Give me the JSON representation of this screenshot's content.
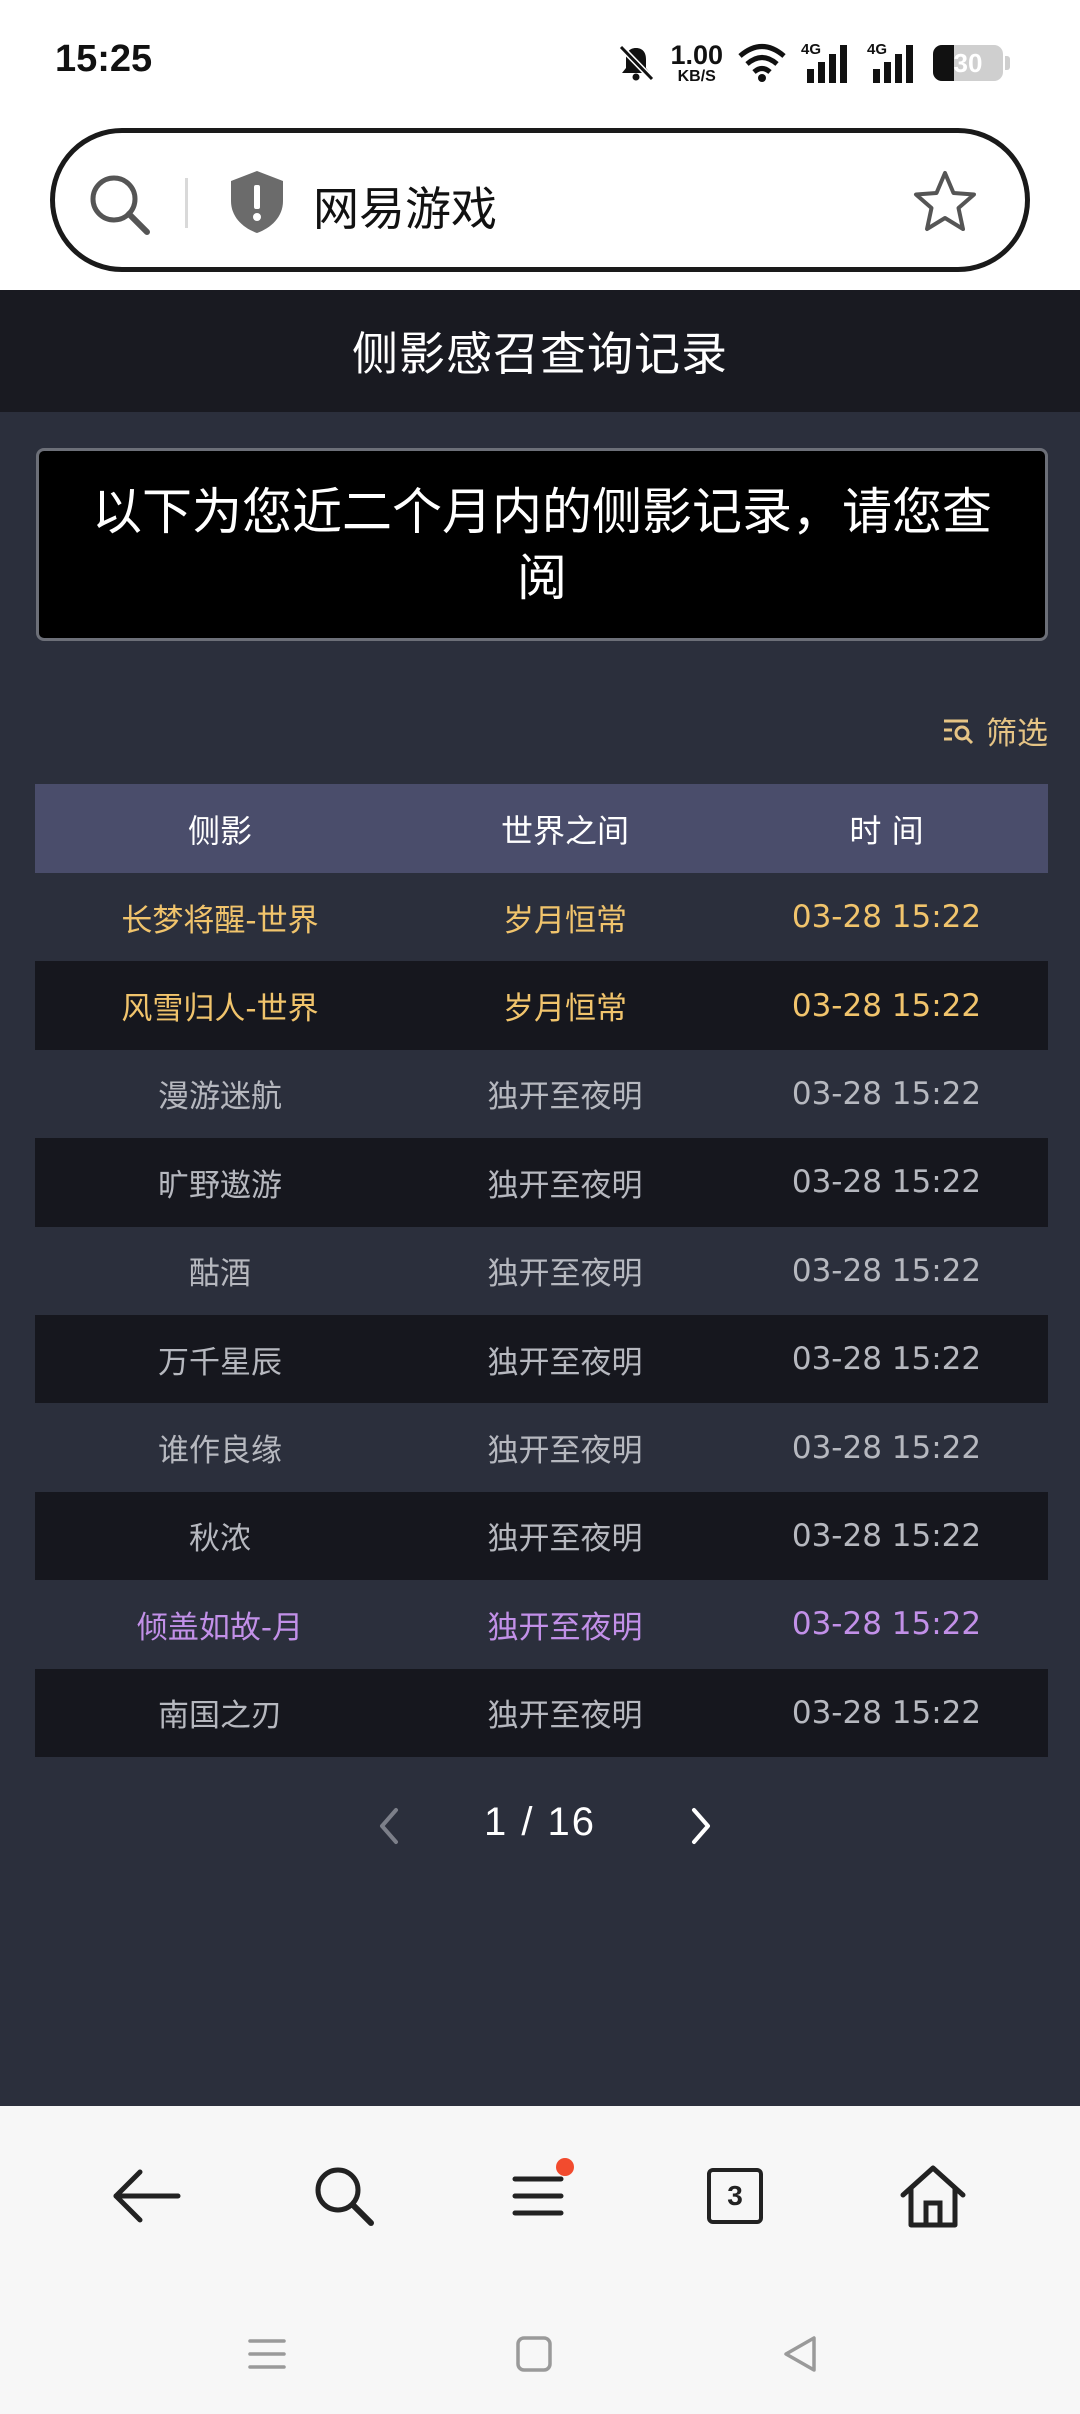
{
  "status_bar": {
    "time": "15:25",
    "net_speed_value": "1.00",
    "net_speed_unit": "KB/S",
    "signal1_tag": "4G",
    "signal2_tag": "4G",
    "battery_level": "30",
    "battery_fraction": 0.3
  },
  "address_bar": {
    "site_title": "网易游戏"
  },
  "page": {
    "header_title": "侧影感召查询记录",
    "notice": "以下为您近二个月内的侧影记录，请您查阅",
    "filter_label": "筛选"
  },
  "table": {
    "columns": [
      "侧影",
      "世界之间",
      "时 间"
    ],
    "rows": [
      {
        "name": "长梦将醒-世界",
        "world": "岁月恒常",
        "time": "03-28 15:22",
        "tone": "gold"
      },
      {
        "name": "风雪归人-世界",
        "world": "岁月恒常",
        "time": "03-28 15:22",
        "tone": "gold"
      },
      {
        "name": "漫游迷航",
        "world": "独开至夜明",
        "time": "03-28 15:22",
        "tone": "grey"
      },
      {
        "name": "旷野遨游",
        "world": "独开至夜明",
        "time": "03-28 15:22",
        "tone": "grey"
      },
      {
        "name": "酤酒",
        "world": "独开至夜明",
        "time": "03-28 15:22",
        "tone": "grey"
      },
      {
        "name": "万千星辰",
        "world": "独开至夜明",
        "time": "03-28 15:22",
        "tone": "grey"
      },
      {
        "name": "谁作良缘",
        "world": "独开至夜明",
        "time": "03-28 15:22",
        "tone": "grey"
      },
      {
        "name": "秋浓",
        "world": "独开至夜明",
        "time": "03-28 15:22",
        "tone": "grey"
      },
      {
        "name": "倾盖如故-月",
        "world": "独开至夜明",
        "time": "03-28 15:22",
        "tone": "purple"
      },
      {
        "name": "南国之刃",
        "world": "独开至夜明",
        "time": "03-28 15:22",
        "tone": "grey"
      }
    ]
  },
  "pagination": {
    "text": "1 / 16",
    "current": 1,
    "total": 16
  },
  "bottom_nav": {
    "tabs_count": "3",
    "icons": [
      "back-arrow-icon",
      "search-icon",
      "menu-icon",
      "tabs-icon",
      "home-icon"
    ]
  },
  "colors": {
    "page_bg": "#2b2f3c",
    "header_bg": "#191a21",
    "table_header_bg": "#4a4d6b",
    "gold": "#f1c46c",
    "purple": "#c290e8",
    "grey": "#b6b8bf",
    "filter": "#e6c485",
    "notification_dot": "#f24b2e"
  }
}
